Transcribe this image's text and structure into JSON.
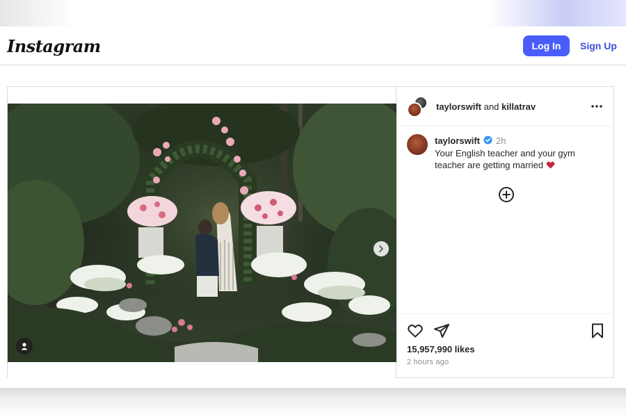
{
  "header": {
    "logo_text": "Instagram",
    "login_label": "Log In",
    "signup_label": "Sign Up",
    "accent_color": "#4a5df9"
  },
  "post": {
    "collab_user": "taylorswift",
    "collab_joiner": "and",
    "collab_partner": "killatrav",
    "more_icon": "more-horizontal-icon",
    "caption": {
      "username": "taylorswift",
      "verified": true,
      "time": "2h",
      "text": "Your English teacher and your gym teacher are getting married",
      "emoji": "heart-emoji"
    },
    "add_comment_icon": "plus-circle-icon",
    "likes_text": "15,957,990 likes",
    "posted_ago": "2 hours ago",
    "media": {
      "next_icon": "chevron-right-icon",
      "tag_icon": "user-tag-icon"
    },
    "action_icons": [
      "heart-icon",
      "send-icon",
      "bookmark-icon"
    ]
  }
}
